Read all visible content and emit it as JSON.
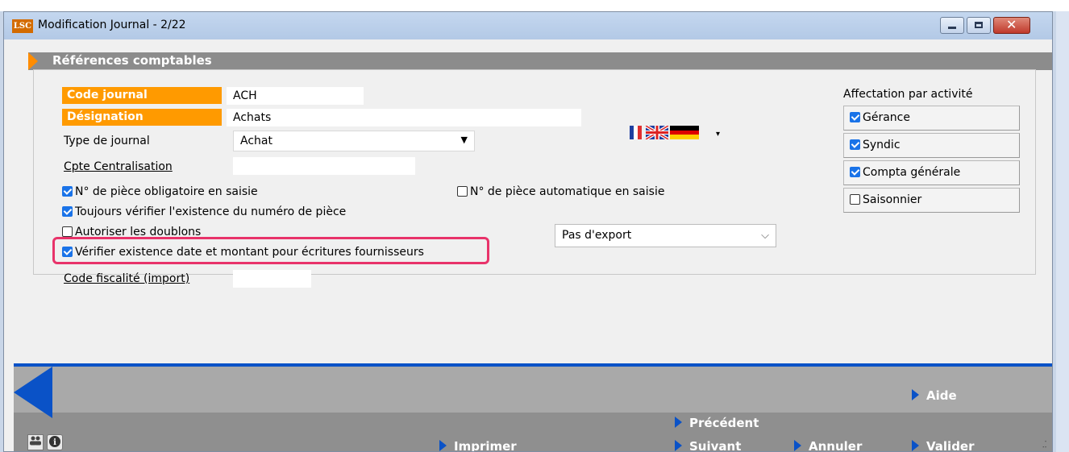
{
  "window": {
    "logo_text": "LSC",
    "title": "Modification Journal - 2/22",
    "controls": {
      "minimize_icon": "minimize-icon",
      "maximize_icon": "maximize-icon",
      "close_icon": "close-icon"
    }
  },
  "section": {
    "title": "Références comptables"
  },
  "form": {
    "code_journal": {
      "label": "Code journal",
      "value": "ACH"
    },
    "designation": {
      "label": "Désignation",
      "value": "Achats",
      "language_dropdown_arrow": "▾"
    },
    "type_journal": {
      "label": "Type de journal",
      "value": "Achat"
    },
    "cpte_centralisation": {
      "label": "Cpte Centralisation",
      "value": ""
    },
    "code_fiscalite": {
      "label": "Code fiscalité (import)",
      "value": ""
    },
    "export_select": {
      "value": "Pas d'export"
    }
  },
  "checkboxes": {
    "piece_obligatoire": {
      "label": "N° de pièce obligatoire en saisie",
      "checked": true
    },
    "piece_automatique": {
      "label": "N° de pièce automatique en saisie",
      "checked": false
    },
    "verifier_numero": {
      "label": "Toujours vérifier l'existence du numéro de pièce",
      "checked": true
    },
    "autoriser_doublons": {
      "label": "Autoriser les doublons",
      "checked": false
    },
    "verifier_date_montant": {
      "label": "Vérifier existence date et montant pour écritures fournisseurs",
      "checked": true
    }
  },
  "activites": {
    "title": "Affectation par activité",
    "items": [
      {
        "label": "Gérance",
        "checked": true
      },
      {
        "label": "Syndic",
        "checked": true
      },
      {
        "label": "Compta générale",
        "checked": true
      },
      {
        "label": "Saisonnier",
        "checked": false
      }
    ]
  },
  "footer": {
    "aide": "Aide",
    "precedent": "Précédent",
    "suivant": "Suivant",
    "imprimer": "Imprimer",
    "annuler": "Annuler",
    "valider": "Valider",
    "users_icon": "users-icon",
    "info_icon": "info-icon"
  },
  "colors": {
    "accent_orange": "#ff9a00",
    "footer_blue": "#0a52c7",
    "highlight": "#e8336a",
    "checkbox_blue": "#1a73e8"
  }
}
